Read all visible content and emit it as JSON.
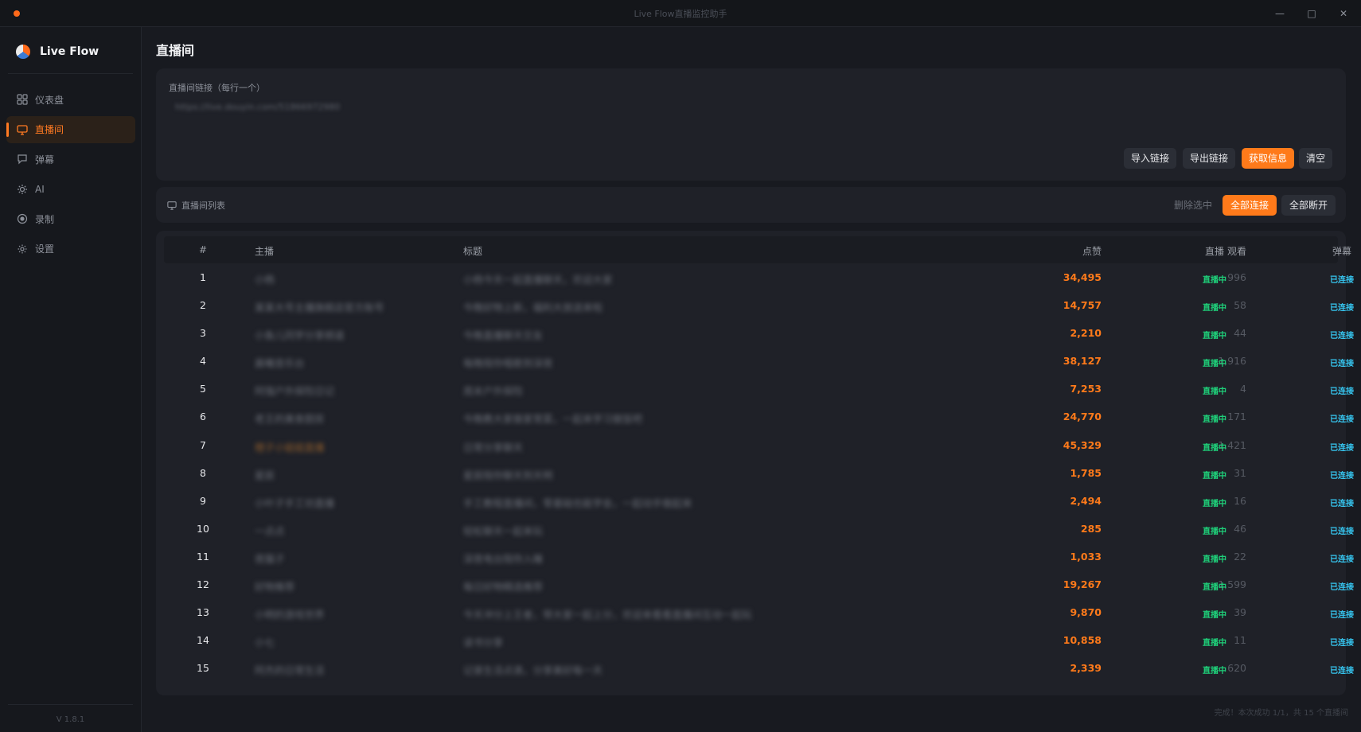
{
  "window": {
    "title": "Live Flow直播监控助手",
    "min_icon": "minimize-icon",
    "max_icon": "maximize-icon",
    "close_icon": "close-icon"
  },
  "sidebar": {
    "brand": "Live Flow",
    "items": [
      {
        "label": "仪表盘",
        "icon": "dashboard-grid-icon",
        "active": false
      },
      {
        "label": "直播间",
        "icon": "monitor-icon",
        "active": true
      },
      {
        "label": "弹幕",
        "icon": "chat-bubble-icon",
        "active": false
      },
      {
        "label": "AI",
        "icon": "sun-sparkle-icon",
        "active": false
      },
      {
        "label": "录制",
        "icon": "record-icon",
        "active": false
      },
      {
        "label": "设置",
        "icon": "gear-icon",
        "active": false
      }
    ],
    "version": "V 1.8.1"
  },
  "page": {
    "title": "直播间"
  },
  "url_panel": {
    "label": "直播间链接（每行一个）",
    "value": "https://live.douyin.com/51866972980",
    "buttons": {
      "import": "导入链接",
      "export": "导出链接",
      "fetch": "获取信息",
      "clear": "清空"
    }
  },
  "list_panel": {
    "title": "直播间列表",
    "buttons": {
      "delete_selected": "删除选中",
      "connect_all": "全部连接",
      "disconnect_all": "全部断开"
    }
  },
  "table": {
    "headers": {
      "index": "#",
      "host": "主播",
      "title": "标题",
      "likes": "点赞",
      "views": "观看",
      "live": "直播",
      "danmaku": "弹幕"
    },
    "rows": [
      {
        "index": "1",
        "host": "小杨",
        "title": "小杨今天一起直播聊天，欢迎大家",
        "likes": "34,495",
        "views": "996",
        "live": "直播中",
        "danmaku": "已连接"
      },
      {
        "index": "2",
        "host": "某某大号主播旗舰店官方账号",
        "title": "今晚好物上新，福利大放送来啦",
        "likes": "14,757",
        "views": "58",
        "live": "直播中",
        "danmaku": "已连接"
      },
      {
        "index": "3",
        "host": "小鱼儿同学分享频道",
        "title": "今晚直播聊天交友",
        "likes": "2,210",
        "views": "44",
        "live": "直播中",
        "danmaku": "已连接"
      },
      {
        "index": "4",
        "host": "晨曦音乐台",
        "title": "每晚陪你唱歌到深夜",
        "likes": "38,127",
        "views": "1,916",
        "live": "直播中",
        "danmaku": "已连接"
      },
      {
        "index": "5",
        "host": "阿强户外探险日记",
        "title": "周末户外探险",
        "likes": "7,253",
        "views": "4",
        "live": "直播中",
        "danmaku": "已连接"
      },
      {
        "index": "6",
        "host": "老王的美食厨房",
        "title": "今晚教大家做家常菜，一起来学习做饭吧",
        "likes": "24,770",
        "views": "171",
        "live": "直播中",
        "danmaku": "已连接"
      },
      {
        "index": "7",
        "host": "橙子小姐姐直播",
        "title": "日常分享聊天",
        "likes": "45,329",
        "views": "1,421",
        "live": "直播中",
        "danmaku": "已连接"
      },
      {
        "index": "8",
        "host": "星辰",
        "title": "星辰陪你聊天到天明",
        "likes": "1,785",
        "views": "31",
        "live": "直播中",
        "danmaku": "已连接"
      },
      {
        "index": "9",
        "host": "小叶子手工坊直播",
        "title": "手工教程直播间，零基础也能学会，一起动手做起来",
        "likes": "2,494",
        "views": "16",
        "live": "直播中",
        "danmaku": "已连接"
      },
      {
        "index": "10",
        "host": "一点点",
        "title": "轻松聊天一起来玩",
        "likes": "285",
        "views": "46",
        "live": "直播中",
        "danmaku": "已连接"
      },
      {
        "index": "11",
        "host": "夜猫子",
        "title": "深夜电台陪你入睡",
        "likes": "1,033",
        "views": "22",
        "live": "直播中",
        "danmaku": "已连接"
      },
      {
        "index": "12",
        "host": "好物推荐",
        "title": "每日好物精选推荐",
        "likes": "19,267",
        "views": "1,599",
        "live": "直播中",
        "danmaku": "已连接"
      },
      {
        "index": "13",
        "host": "小明的游戏世界",
        "title": "今天冲分上王者，带大家一起上分，欢迎来看看直播间互动一起玩",
        "likes": "9,870",
        "views": "39",
        "live": "直播中",
        "danmaku": "已连接"
      },
      {
        "index": "14",
        "host": "小七",
        "title": "读书分享",
        "likes": "10,858",
        "views": "11",
        "live": "直播中",
        "danmaku": "已连接"
      },
      {
        "index": "15",
        "host": "阿杰的日常生活",
        "title": "记录生活点滴，分享美好每一天",
        "likes": "2,339",
        "views": "620",
        "live": "直播中",
        "danmaku": "已连接"
      }
    ]
  },
  "status": "完成！本次成功 1/1，共 15 个直播间",
  "colors": {
    "accent": "#ff7a1a",
    "live": "#1fd07a",
    "connected": "#36c6f0",
    "background": "#181a20",
    "panel": "#1f2128"
  }
}
